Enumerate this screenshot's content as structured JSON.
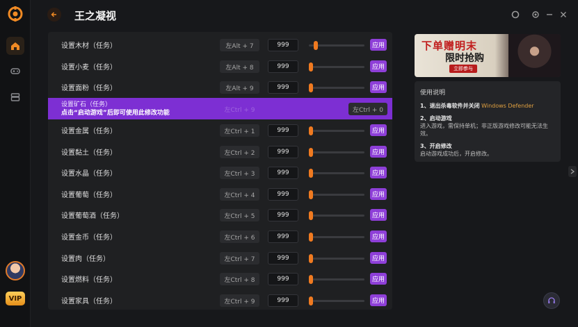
{
  "app": {
    "title": "王之凝视"
  },
  "rows": [
    {
      "label": "设置木材（任务）",
      "hotkey": "左Alt + 7",
      "value": "999",
      "slider": 0.1,
      "apply": "应用"
    },
    {
      "label": "设置小麦（任务）",
      "hotkey": "左Alt + 8",
      "value": "999",
      "slider": 0.0,
      "apply": "应用"
    },
    {
      "label": "设置面粉（任务）",
      "hotkey": "左Alt + 9",
      "value": "999",
      "slider": 0.0,
      "apply": "应用"
    },
    {
      "label": "设置金属（任务）",
      "hotkey": "左Ctrl + 1",
      "value": "999",
      "slider": 0.0,
      "apply": "应用"
    },
    {
      "label": "设置黏土（任务）",
      "hotkey": "左Ctrl + 2",
      "value": "999",
      "slider": 0.0,
      "apply": "应用"
    },
    {
      "label": "设置水晶（任务）",
      "hotkey": "左Ctrl + 3",
      "value": "999",
      "slider": 0.0,
      "apply": "应用"
    },
    {
      "label": "设置葡萄（任务）",
      "hotkey": "左Ctrl + 4",
      "value": "999",
      "slider": 0.0,
      "apply": "应用"
    },
    {
      "label": "设置葡萄酒（任务）",
      "hotkey": "左Ctrl + 5",
      "value": "999",
      "slider": 0.0,
      "apply": "应用"
    },
    {
      "label": "设置金币（任务）",
      "hotkey": "左Ctrl + 6",
      "value": "999",
      "slider": 0.0,
      "apply": "应用"
    },
    {
      "label": "设置肉（任务）",
      "hotkey": "左Ctrl + 7",
      "value": "999",
      "slider": 0.0,
      "apply": "应用"
    },
    {
      "label": "设置燃料（任务）",
      "hotkey": "左Ctrl + 8",
      "value": "999",
      "slider": 0.0,
      "apply": "应用"
    },
    {
      "label": "设置家具（任务）",
      "hotkey": "左Ctrl + 9",
      "value": "999",
      "slider": 0.0,
      "apply": "应用"
    }
  ],
  "notice_row": {
    "label": "设置矿石（任务）",
    "message": "点击“启动游戏”后即可使用此修改功能",
    "ghost_hotkey": "左Ctrl + 9",
    "hotkey": "左Ctrl + 0"
  },
  "banner": {
    "line1": "下单赠明末",
    "line2": "限时抢购",
    "tag": "立即参与"
  },
  "instructions": {
    "title": "使用说明",
    "step1_title": "1、退出杀毒软件并关闭",
    "step1_highlight": "Windows Defender",
    "step2_title": "2、启动游戏",
    "step2_body": "进入游戏，需保持单机；非正版游戏修改可能无法生效。",
    "step3_title": "3、开启修改",
    "step3_body": "启动游戏成功后，开启修改。"
  },
  "sidebar": {
    "vip": "VIP"
  },
  "colors": {
    "accent": "#f07a20",
    "apply": "#8e3fd8",
    "notice": "#7d2fd3"
  }
}
